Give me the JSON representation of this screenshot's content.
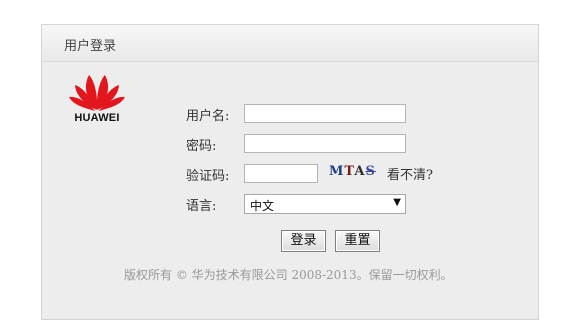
{
  "header": {
    "title": "用户登录"
  },
  "logo": {
    "text": "HUAWEI"
  },
  "form": {
    "username_label": "用户名:",
    "username_value": "",
    "password_label": "密码:",
    "password_value": "",
    "captcha_label": "验证码:",
    "captcha_value": "",
    "captcha_image_text": [
      "M",
      "T",
      "A",
      "S"
    ],
    "captcha_refresh": "看不清?",
    "language_label": "语言:",
    "language_selected": "中文",
    "login_button": "登录",
    "reset_button": "重置"
  },
  "footer": {
    "copyright": "版权所有 © 华为技术有限公司 2008-2013。保留一切权利。"
  },
  "colors": {
    "logo_red": "#e3161d",
    "panel_bg": "#ededed"
  },
  "icons": {
    "dropdown": "chevron-down-icon"
  }
}
